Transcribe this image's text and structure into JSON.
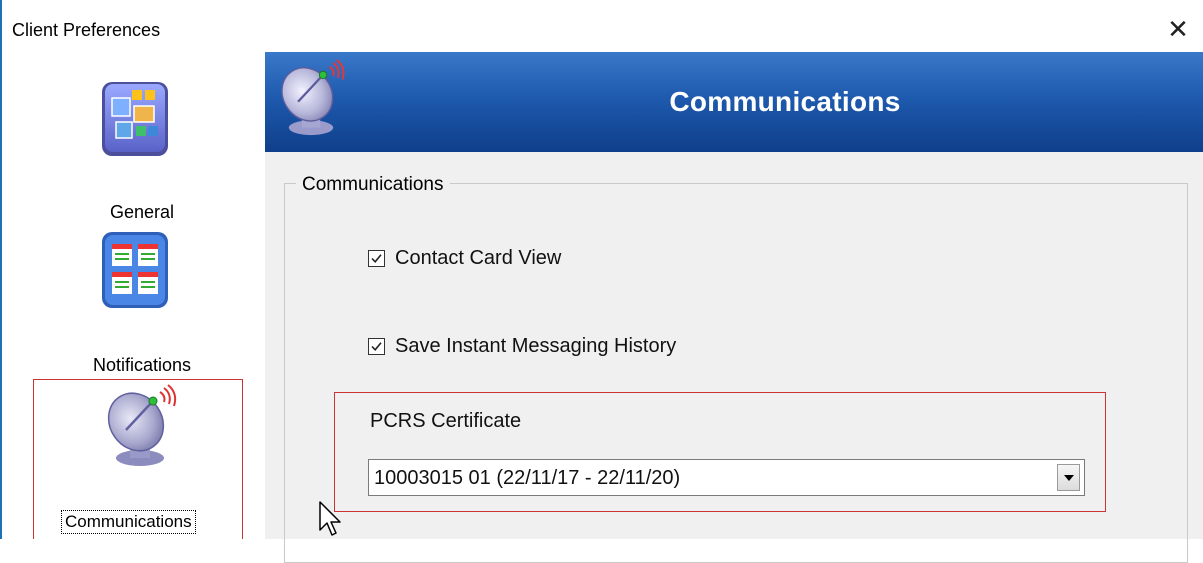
{
  "window": {
    "title": "Client Preferences",
    "close_glyph": "✕"
  },
  "sidebar": {
    "items": [
      {
        "label": "General",
        "icon": "general-panels-icon"
      },
      {
        "label": "Notifications",
        "icon": "notifications-board-icon"
      },
      {
        "label": "Communications",
        "icon": "satellite-dish-icon",
        "selected": true
      }
    ]
  },
  "header": {
    "title": "Communications",
    "icon": "satellite-dish-icon"
  },
  "group": {
    "legend": "Communications",
    "options": [
      {
        "label": "Contact Card View",
        "checked": true
      },
      {
        "label": "Save Instant Messaging History",
        "checked": true
      }
    ],
    "certificate": {
      "label": "PCRS Certificate",
      "selected_value": "10003015 01 (22/11/17 - 22/11/20)"
    }
  },
  "colors": {
    "header_gradient_top": "#3a78c9",
    "header_gradient_bottom": "#0f3f8a",
    "highlight_frame": "#cc3333",
    "panel_bg": "#f0f0f0"
  }
}
